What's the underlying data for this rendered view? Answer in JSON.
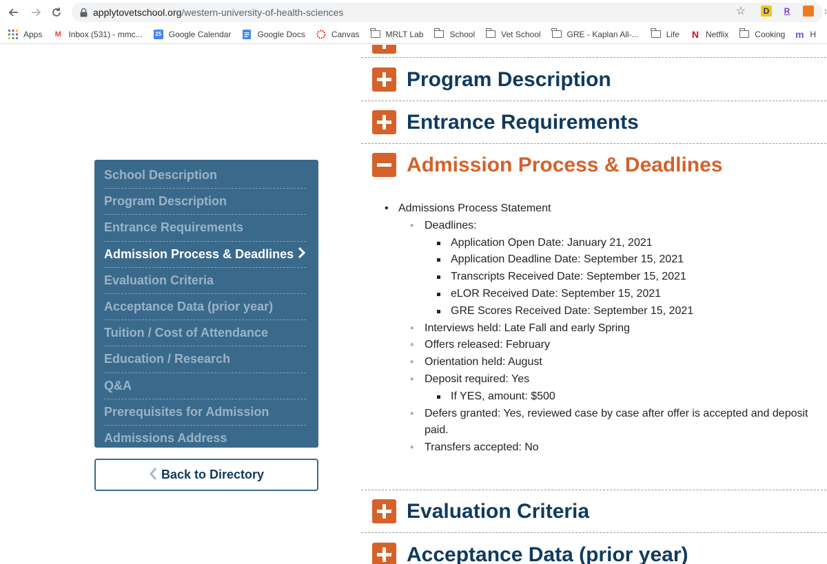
{
  "browser": {
    "url_host": "applytovetschool.org",
    "url_path": "/western-university-of-health-sciences",
    "extensions": [
      "D",
      "R",
      "ext-orange",
      ":"
    ],
    "bookmarks": [
      {
        "label": "Apps",
        "icon": "apps-grid-icon"
      },
      {
        "label": "Inbox (531) - mmc...",
        "icon": "gmail-icon"
      },
      {
        "label": "Google Calendar",
        "icon": "calendar-icon"
      },
      {
        "label": "Google Docs",
        "icon": "docs-icon"
      },
      {
        "label": "Canvas",
        "icon": "canvas-icon"
      },
      {
        "label": "MRLT Lab",
        "icon": "folder-icon"
      },
      {
        "label": "School",
        "icon": "folder-icon"
      },
      {
        "label": "Vet School",
        "icon": "folder-icon"
      },
      {
        "label": "GRE - Kaplan All-...",
        "icon": "folder-icon"
      },
      {
        "label": "Life",
        "icon": "folder-icon"
      },
      {
        "label": "Netflix",
        "icon": "netflix-icon"
      },
      {
        "label": "Cooking",
        "icon": "folder-icon"
      },
      {
        "label": "H",
        "icon": "m-icon"
      }
    ]
  },
  "sidebar": {
    "items": [
      {
        "label": "School Description",
        "active": false
      },
      {
        "label": "Program Description",
        "active": false
      },
      {
        "label": "Entrance Requirements",
        "active": false
      },
      {
        "label": "Admission Process & Deadlines",
        "active": true
      },
      {
        "label": "Evaluation Criteria",
        "active": false
      },
      {
        "label": "Acceptance Data (prior year)",
        "active": false
      },
      {
        "label": "Tuition / Cost of Attendance",
        "active": false
      },
      {
        "label": "Education / Research",
        "active": false
      },
      {
        "label": "Q&A",
        "active": false
      },
      {
        "label": "Prerequisites for Admission",
        "active": false
      },
      {
        "label": "Admissions Address",
        "active": false
      }
    ],
    "back_label": "Back to Directory"
  },
  "sections": {
    "program_description": "Program Description",
    "entrance_requirements": "Entrance Requirements",
    "admission_process": "Admission Process & Deadlines",
    "evaluation_criteria": "Evaluation Criteria",
    "acceptance_data": "Acceptance Data (prior year)"
  },
  "admission": {
    "statement": "Admissions Process Statement",
    "deadlines_label": "Deadlines:",
    "deadlines": [
      "Application Open Date: January 21, 2021",
      "Application Deadline Date: September 15, 2021",
      "Transcripts Received Date: September 15, 2021",
      "eLOR Received Date: September 15, 2021",
      "GRE Scores Received Date: September 15, 2021"
    ],
    "interviews": "Interviews held: Late Fall and early Spring",
    "offers": "Offers released: February",
    "orientation": "Orientation held: August",
    "deposit": "Deposit required: Yes",
    "deposit_amount": "If YES, amount: $500",
    "defers": "Defers granted: Yes, reviewed case by case after offer is accepted and deposit paid.",
    "transfers": "Transfers accepted: No"
  }
}
